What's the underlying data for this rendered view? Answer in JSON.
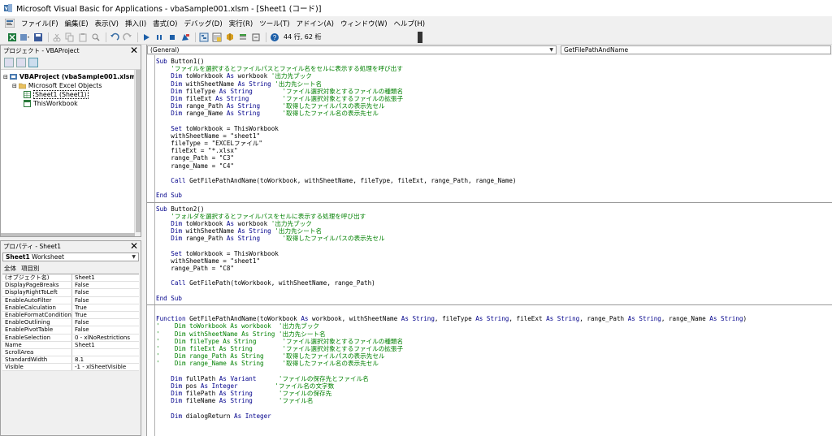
{
  "window": {
    "title": "Microsoft Visual Basic for Applications - vbaSample001.xlsm - [Sheet1 (コード)]"
  },
  "menu": [
    {
      "label": "ファイル(F)"
    },
    {
      "label": "編集(E)"
    },
    {
      "label": "表示(V)"
    },
    {
      "label": "挿入(I)"
    },
    {
      "label": "書式(O)"
    },
    {
      "label": "デバッグ(D)"
    },
    {
      "label": "実行(R)"
    },
    {
      "label": "ツール(T)"
    },
    {
      "label": "アドイン(A)"
    },
    {
      "label": "ウィンドウ(W)"
    },
    {
      "label": "ヘルプ(H)"
    }
  ],
  "toolbar": {
    "position": "44 行, 62 桁",
    "icons": [
      "view-excel-icon",
      "insert-module-icon",
      "save-icon",
      "cut-icon",
      "copy-icon",
      "paste-icon",
      "find-icon",
      "undo-icon",
      "redo-icon",
      "run-icon",
      "break-icon",
      "reset-icon",
      "design-mode-icon",
      "project-explorer-icon",
      "properties-icon",
      "object-browser-icon",
      "toolbox-icon",
      "help-icon"
    ]
  },
  "project_pane": {
    "title": "プロジェクト - VBAProject",
    "tree": [
      {
        "label": "VBAProject (vbaSample001.xlsm)",
        "depth": 0,
        "bold": true,
        "icon": "vbproject-icon"
      },
      {
        "label": "Microsoft Excel Objects",
        "depth": 1,
        "bold": false,
        "icon": "folder-icon"
      },
      {
        "label": "Sheet1 (Sheet1)",
        "depth": 2,
        "bold": false,
        "icon": "sheet-icon",
        "selected": true
      },
      {
        "label": "ThisWorkbook",
        "depth": 2,
        "bold": false,
        "icon": "workbook-icon"
      }
    ]
  },
  "props_pane": {
    "title": "プロパティ - Sheet1",
    "object_name": "Sheet1",
    "object_type": "Worksheet",
    "tabs": [
      "全体",
      "項目別"
    ],
    "rows": [
      {
        "key": "(オブジェクト名)",
        "value": "Sheet1"
      },
      {
        "key": "DisplayPageBreaks",
        "value": "False"
      },
      {
        "key": "DisplayRightToLeft",
        "value": "False"
      },
      {
        "key": "EnableAutoFilter",
        "value": "False"
      },
      {
        "key": "EnableCalculation",
        "value": "True"
      },
      {
        "key": "EnableFormatConditionsC",
        "value": "True"
      },
      {
        "key": "EnableOutlining",
        "value": "False"
      },
      {
        "key": "EnablePivotTable",
        "value": "False"
      },
      {
        "key": "EnableSelection",
        "value": "0 - xlNoRestrictions"
      },
      {
        "key": "Name",
        "value": "Sheet1"
      },
      {
        "key": "ScrollArea",
        "value": ""
      },
      {
        "key": "StandardWidth",
        "value": "8.1"
      },
      {
        "key": "Visible",
        "value": "-1 - xlSheetVisible"
      }
    ]
  },
  "code": {
    "object_combo": "(General)",
    "proc_combo": "GetFilePathAndName",
    "procedures": [
      [
        [
          [
            "kw",
            "Sub"
          ],
          [
            "t",
            " Button1()"
          ]
        ],
        [
          [
            "cm",
            "    'ファイルを選択するとファイルパスとファイル名をセルに表示する処理を呼び出す"
          ]
        ],
        [
          [
            "t",
            "    "
          ],
          [
            "kw",
            "Dim"
          ],
          [
            "t",
            " toWorkbook "
          ],
          [
            "kw",
            "As"
          ],
          [
            "t",
            " workbook "
          ],
          [
            "cm",
            "'出力先ブック"
          ]
        ],
        [
          [
            "t",
            "    "
          ],
          [
            "kw",
            "Dim"
          ],
          [
            "t",
            " withSheetName "
          ],
          [
            "kw",
            "As String"
          ],
          [
            "t",
            " "
          ],
          [
            "cm",
            "'出力先シート名"
          ]
        ],
        [
          [
            "t",
            "    "
          ],
          [
            "kw",
            "Dim"
          ],
          [
            "t",
            " fileType "
          ],
          [
            "kw",
            "As String"
          ],
          [
            "t",
            "        "
          ],
          [
            "cm",
            "'ファイル選択対象とするファイルの種類名"
          ]
        ],
        [
          [
            "t",
            "    "
          ],
          [
            "kw",
            "Dim"
          ],
          [
            "t",
            " fileExt "
          ],
          [
            "kw",
            "As String"
          ],
          [
            "t",
            "         "
          ],
          [
            "cm",
            "'ファイル選択対象とするファイルの拡張子"
          ]
        ],
        [
          [
            "t",
            "    "
          ],
          [
            "kw",
            "Dim"
          ],
          [
            "t",
            " range_Path "
          ],
          [
            "kw",
            "As String"
          ],
          [
            "t",
            "      "
          ],
          [
            "cm",
            "'取得したファイルパスの表示先セル"
          ]
        ],
        [
          [
            "t",
            "    "
          ],
          [
            "kw",
            "Dim"
          ],
          [
            "t",
            " range_Name "
          ],
          [
            "kw",
            "As String"
          ],
          [
            "t",
            "      "
          ],
          [
            "cm",
            "'取得したファイル名の表示先セル"
          ]
        ],
        [
          [
            "t",
            ""
          ]
        ],
        [
          [
            "t",
            "    "
          ],
          [
            "kw",
            "Set"
          ],
          [
            "t",
            " toWorkbook = ThisWorkbook"
          ]
        ],
        [
          [
            "t",
            "    withSheetName = \"sheet1\""
          ]
        ],
        [
          [
            "t",
            "    fileType = \"EXCELファイル\""
          ]
        ],
        [
          [
            "t",
            "    fileExt = \"*.xlsx\""
          ]
        ],
        [
          [
            "t",
            "    range_Path = \"C3\""
          ]
        ],
        [
          [
            "t",
            "    range_Name = \"C4\""
          ]
        ],
        [
          [
            "t",
            ""
          ]
        ],
        [
          [
            "t",
            "    "
          ],
          [
            "kw",
            "Call"
          ],
          [
            "t",
            " GetFilePathAndName(toWorkbook, withSheetName, fileType, fileExt, range_Path, range_Name)"
          ]
        ],
        [
          [
            "t",
            ""
          ]
        ],
        [
          [
            "kw",
            "End Sub"
          ]
        ]
      ],
      [
        [
          [
            "kw",
            "Sub"
          ],
          [
            "t",
            " Button2()"
          ]
        ],
        [
          [
            "cm",
            "    'フォルダを選択するとファイルパスをセルに表示する処理を呼び出す"
          ]
        ],
        [
          [
            "t",
            "    "
          ],
          [
            "kw",
            "Dim"
          ],
          [
            "t",
            " toWorkbook "
          ],
          [
            "kw",
            "As"
          ],
          [
            "t",
            " workbook "
          ],
          [
            "cm",
            "'出力先ブック"
          ]
        ],
        [
          [
            "t",
            "    "
          ],
          [
            "kw",
            "Dim"
          ],
          [
            "t",
            " withSheetName "
          ],
          [
            "kw",
            "As String"
          ],
          [
            "t",
            " "
          ],
          [
            "cm",
            "'出力先シート名"
          ]
        ],
        [
          [
            "t",
            "    "
          ],
          [
            "kw",
            "Dim"
          ],
          [
            "t",
            " range_Path "
          ],
          [
            "kw",
            "As String"
          ],
          [
            "t",
            "      "
          ],
          [
            "cm",
            "'取得したファイルパスの表示先セル"
          ]
        ],
        [
          [
            "t",
            ""
          ]
        ],
        [
          [
            "t",
            "    "
          ],
          [
            "kw",
            "Set"
          ],
          [
            "t",
            " toWorkbook = ThisWorkbook"
          ]
        ],
        [
          [
            "t",
            "    withSheetName = \"sheet1\""
          ]
        ],
        [
          [
            "t",
            "    range_Path = \"C8\""
          ]
        ],
        [
          [
            "t",
            ""
          ]
        ],
        [
          [
            "t",
            "    "
          ],
          [
            "kw",
            "Call"
          ],
          [
            "t",
            " GetFilePath(toWorkbook, withSheetName, range_Path)"
          ]
        ],
        [
          [
            "t",
            ""
          ]
        ],
        [
          [
            "kw",
            "End Sub"
          ]
        ]
      ],
      [
        [
          [
            "t",
            ""
          ]
        ],
        [
          [
            "kw",
            "Function"
          ],
          [
            "t",
            " GetFilePathAndName(toWorkbook "
          ],
          [
            "kw",
            "As"
          ],
          [
            "t",
            " workbook, withSheetName "
          ],
          [
            "kw",
            "As String"
          ],
          [
            "t",
            ", fileType "
          ],
          [
            "kw",
            "As String"
          ],
          [
            "t",
            ", fileExt "
          ],
          [
            "kw",
            "As String"
          ],
          [
            "t",
            ", range_Path "
          ],
          [
            "kw",
            "As String"
          ],
          [
            "t",
            ", range_Name "
          ],
          [
            "kw",
            "As String"
          ],
          [
            "t",
            ")"
          ]
        ],
        [
          [
            "cm",
            "'    Dim toWorkbook As workbook  '出力先ブック"
          ]
        ],
        [
          [
            "cm",
            "'    Dim withSheetName As String '出力先シート名"
          ]
        ],
        [
          [
            "cm",
            "'    Dim fileType As String       'ファイル選択対象とするファイルの種類名"
          ]
        ],
        [
          [
            "cm",
            "'    Dim fileExt As String        'ファイル選択対象とするファイルの拡張子"
          ]
        ],
        [
          [
            "cm",
            "'    Dim range_Path As String     '取得したファイルパスの表示先セル"
          ]
        ],
        [
          [
            "cm",
            "'    Dim range_Name As String     '取得したファイル名の表示先セル"
          ]
        ],
        [
          [
            "t",
            ""
          ]
        ],
        [
          [
            "t",
            "    "
          ],
          [
            "kw",
            "Dim"
          ],
          [
            "t",
            " fullPath "
          ],
          [
            "kw",
            "As Variant"
          ],
          [
            "t",
            "      "
          ],
          [
            "cm",
            "'ファイルの保存先とファイル名"
          ]
        ],
        [
          [
            "t",
            "    "
          ],
          [
            "kw",
            "Dim"
          ],
          [
            "t",
            " pos "
          ],
          [
            "kw",
            "As Integer"
          ],
          [
            "t",
            "          "
          ],
          [
            "cm",
            "'ファイル名の文字数"
          ]
        ],
        [
          [
            "t",
            "    "
          ],
          [
            "kw",
            "Dim"
          ],
          [
            "t",
            " filePath "
          ],
          [
            "kw",
            "As String"
          ],
          [
            "t",
            "       "
          ],
          [
            "cm",
            "'ファイルの保存先"
          ]
        ],
        [
          [
            "t",
            "    "
          ],
          [
            "kw",
            "Dim"
          ],
          [
            "t",
            " fileName "
          ],
          [
            "kw",
            "As String"
          ],
          [
            "t",
            "       "
          ],
          [
            "cm",
            "'ファイル名"
          ]
        ],
        [
          [
            "t",
            ""
          ]
        ],
        [
          [
            "t",
            "    "
          ],
          [
            "kw",
            "Dim"
          ],
          [
            "t",
            " dialogReturn "
          ],
          [
            "kw",
            "As Integer"
          ]
        ]
      ]
    ]
  }
}
